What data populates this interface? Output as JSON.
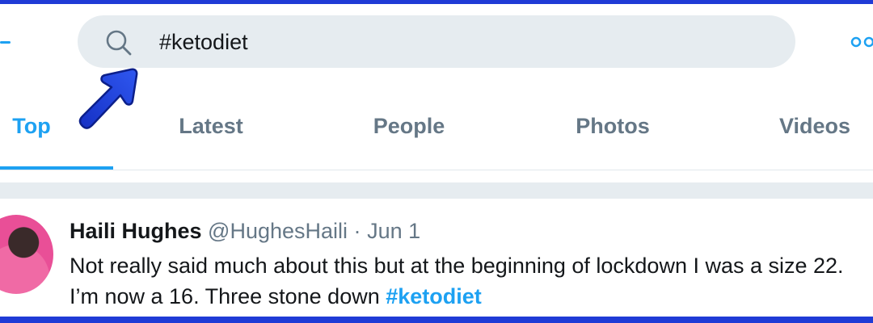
{
  "search": {
    "query": "#ketodiet"
  },
  "tabs": [
    {
      "label": "Top",
      "active": true
    },
    {
      "label": "Latest",
      "active": false
    },
    {
      "label": "People",
      "active": false
    },
    {
      "label": "Photos",
      "active": false
    },
    {
      "label": "Videos",
      "active": false
    }
  ],
  "tweet": {
    "display_name": "Haili Hughes",
    "handle": "@HughesHaili",
    "separator": "·",
    "date": "Jun 1",
    "text": "Not really said much about this but at the beginning of lockdown I was a size 22. I’m now a 16. Three stone down ",
    "hashtag": "#ketodiet"
  },
  "icons": {
    "back": "back-arrow-icon",
    "search": "search-icon",
    "more": "more-options-icon",
    "annotation": "annotation-arrow-icon"
  },
  "colors": {
    "accent": "#1da1f2",
    "frame": "#1f3bd6",
    "muted": "#657786",
    "search_bg": "#e6ecf0"
  }
}
